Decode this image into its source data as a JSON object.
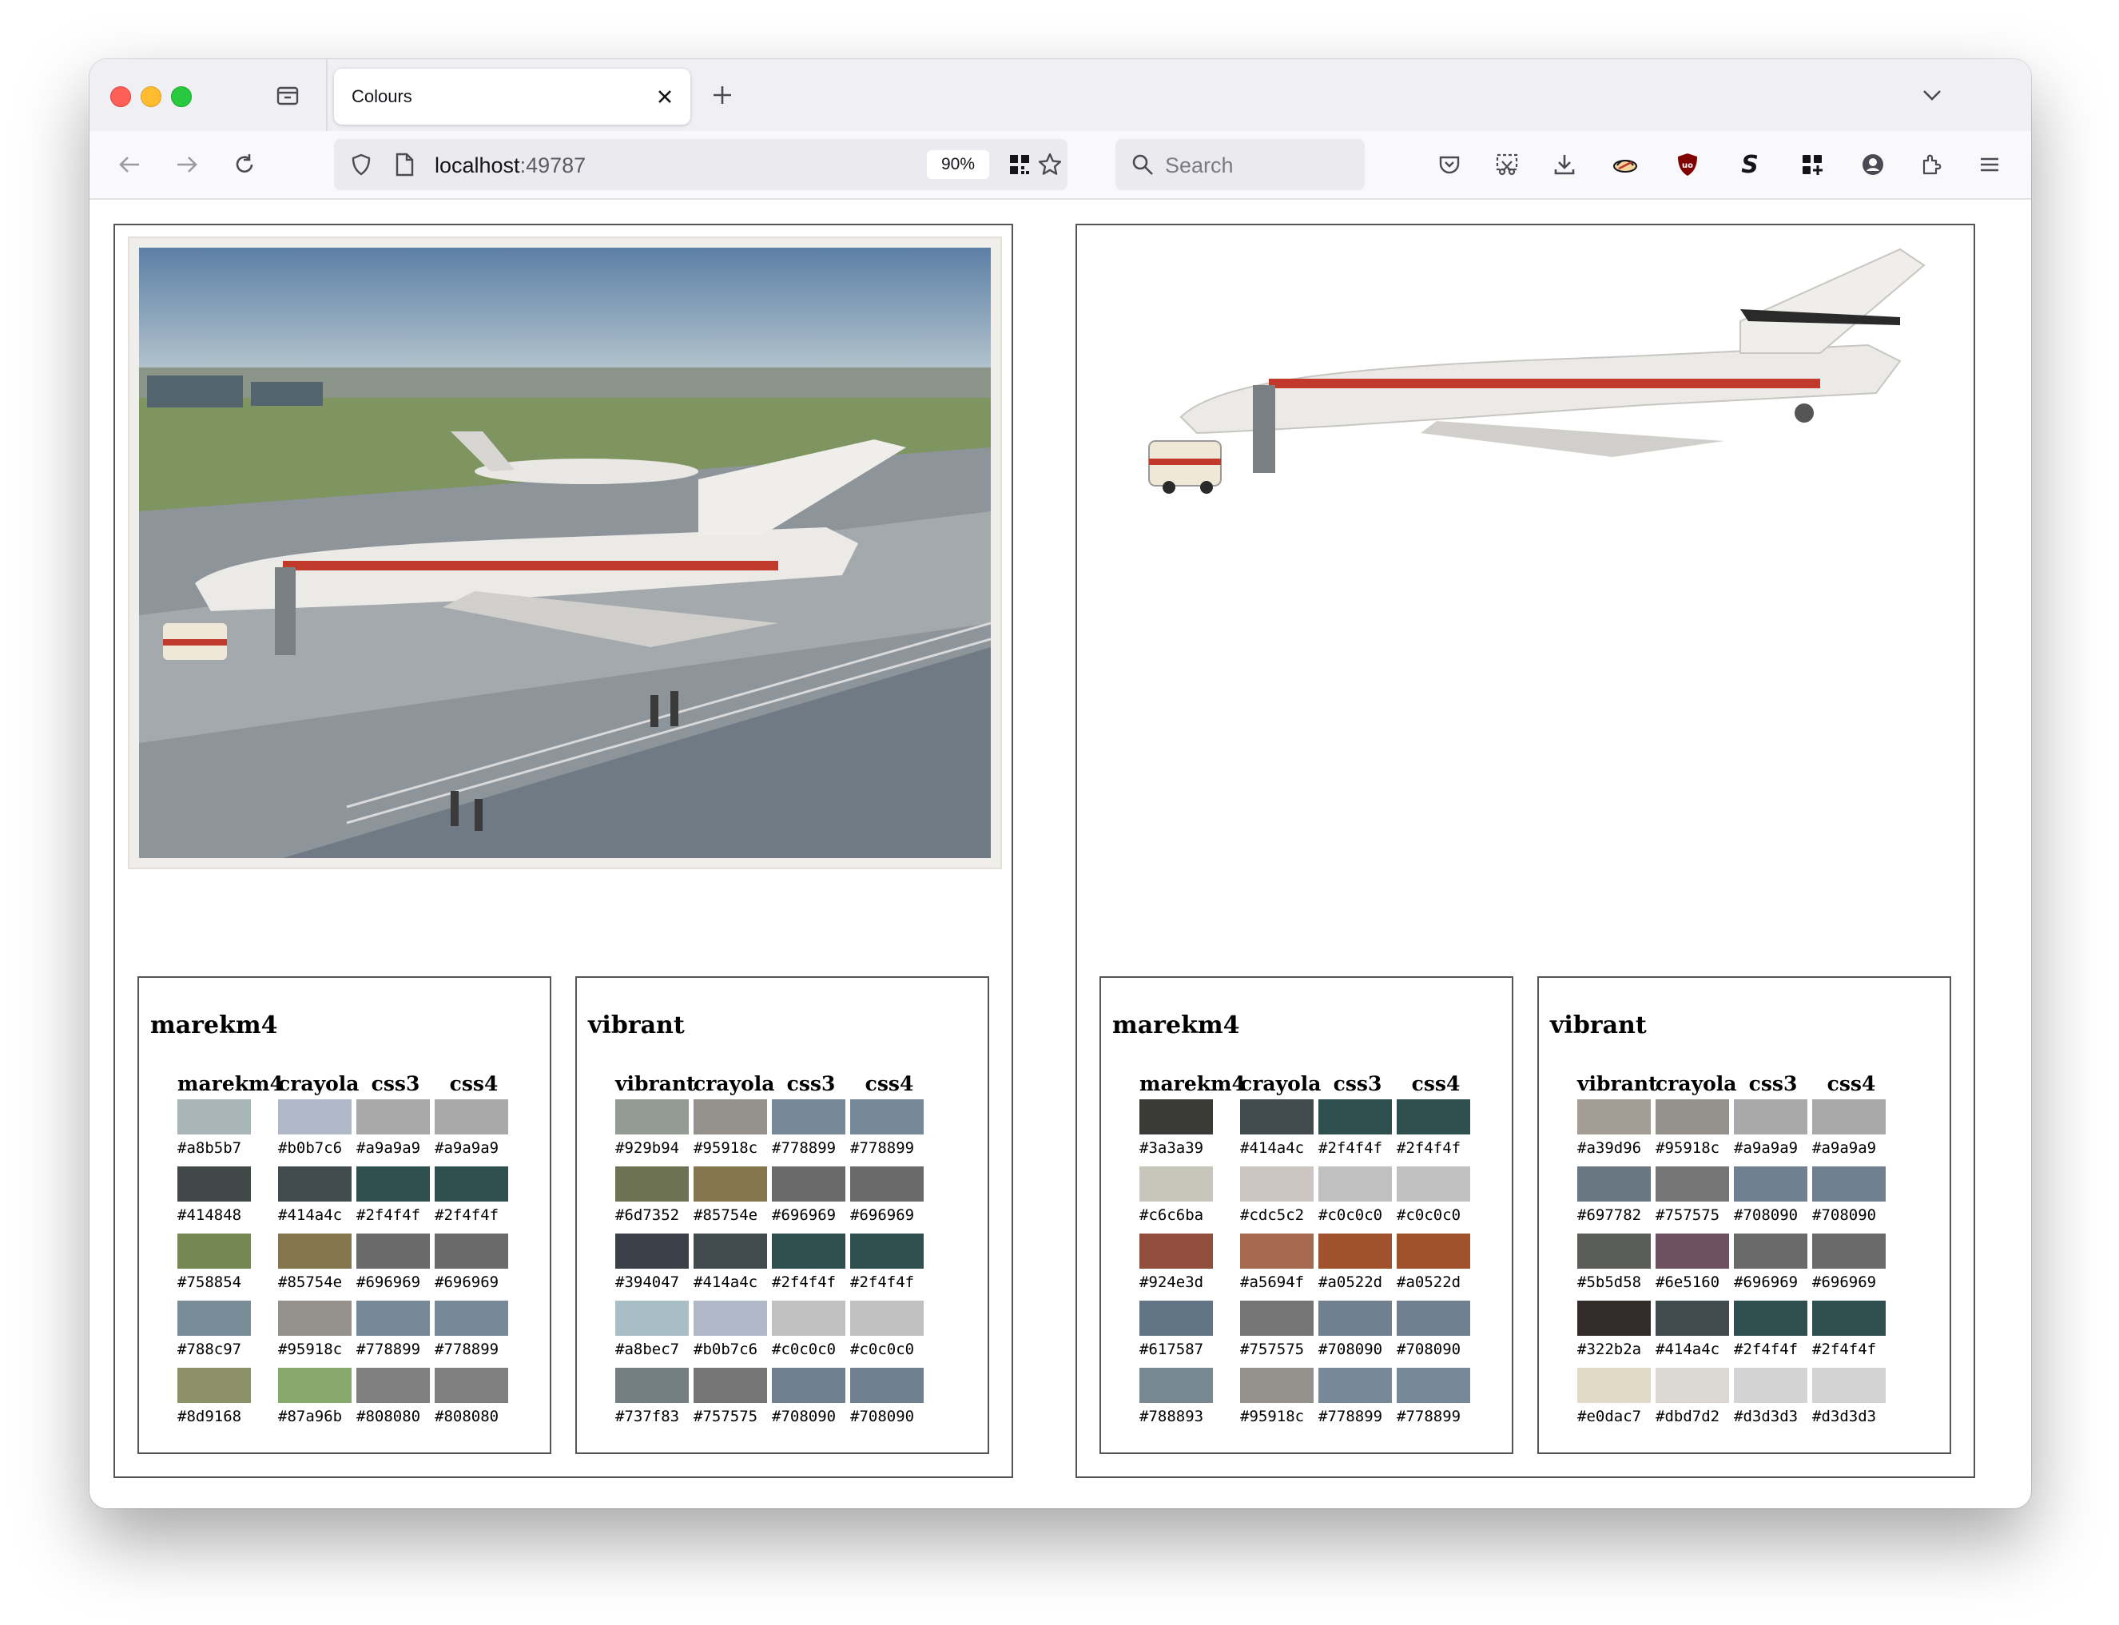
{
  "browser": {
    "tab_title": "Colours",
    "url_host": "localhost",
    "url_port": ":49787",
    "zoom": "90%",
    "search_placeholder": "Search"
  },
  "panels": [
    {
      "image_alt": "Japan Air Lines Boeing 727 aircraft at airport apron",
      "tables": [
        {
          "title": "marekm4",
          "headers": [
            "marekm4",
            "crayola",
            "css3",
            "css4"
          ],
          "rows": [
            [
              "#a8b5b7",
              "#b0b7c6",
              "#a9a9a9",
              "#a9a9a9"
            ],
            [
              "#414848",
              "#414a4c",
              "#2f4f4f",
              "#2f4f4f"
            ],
            [
              "#758854",
              "#85754e",
              "#696969",
              "#696969"
            ],
            [
              "#788c97",
              "#95918c",
              "#778899",
              "#778899"
            ],
            [
              "#8d9168",
              "#87a96b",
              "#808080",
              "#808080"
            ]
          ]
        },
        {
          "title": "vibrant",
          "headers": [
            "vibrant",
            "crayola",
            "css3",
            "css4"
          ],
          "rows": [
            [
              "#929b94",
              "#95918c",
              "#778899",
              "#778899"
            ],
            [
              "#6d7352",
              "#85754e",
              "#696969",
              "#696969"
            ],
            [
              "#394047",
              "#414a4c",
              "#2f4f4f",
              "#2f4f4f"
            ],
            [
              "#a8bec7",
              "#b0b7c6",
              "#c0c0c0",
              "#c0c0c0"
            ],
            [
              "#737f83",
              "#757575",
              "#708090",
              "#708090"
            ]
          ]
        }
      ]
    },
    {
      "image_alt": "Japan Air Lines Boeing 727 aircraft cutout",
      "tables": [
        {
          "title": "marekm4",
          "headers": [
            "marekm4",
            "crayola",
            "css3",
            "css4"
          ],
          "rows": [
            [
              "#3a3a39",
              "#414a4c",
              "#2f4f4f",
              "#2f4f4f"
            ],
            [
              "#c6c6ba",
              "#cdc5c2",
              "#c0c0c0",
              "#c0c0c0"
            ],
            [
              "#924e3d",
              "#a5694f",
              "#a0522d",
              "#a0522d"
            ],
            [
              "#617587",
              "#757575",
              "#708090",
              "#708090"
            ],
            [
              "#788893",
              "#95918c",
              "#778899",
              "#778899"
            ]
          ]
        },
        {
          "title": "vibrant",
          "headers": [
            "vibrant",
            "crayola",
            "css3",
            "css4"
          ],
          "rows": [
            [
              "#a39d96",
              "#95918c",
              "#a9a9a9",
              "#a9a9a9"
            ],
            [
              "#697782",
              "#757575",
              "#708090",
              "#708090"
            ],
            [
              "#5b5d58",
              "#6e5160",
              "#696969",
              "#696969"
            ],
            [
              "#322b2a",
              "#414a4c",
              "#2f4f4f",
              "#2f4f4f"
            ],
            [
              "#e0dac7",
              "#dbd7d2",
              "#d3d3d3",
              "#d3d3d3"
            ]
          ]
        }
      ]
    }
  ],
  "icons": {
    "toolbar": [
      "tab-overview-icon",
      "close-icon",
      "new-tab-icon",
      "tab-list-chevron-icon",
      "back-icon",
      "forward-icon",
      "reload-icon",
      "shield-icon",
      "page-icon",
      "qr-code-icon",
      "bookmark-star-icon",
      "search-icon",
      "pocket-icon",
      "screenshot-icon",
      "download-icon",
      "extension-icon",
      "ublock-icon",
      "s-extension-icon",
      "grid-extension-icon",
      "account-icon",
      "extensions-puzzle-icon",
      "hamburger-menu-icon"
    ]
  }
}
